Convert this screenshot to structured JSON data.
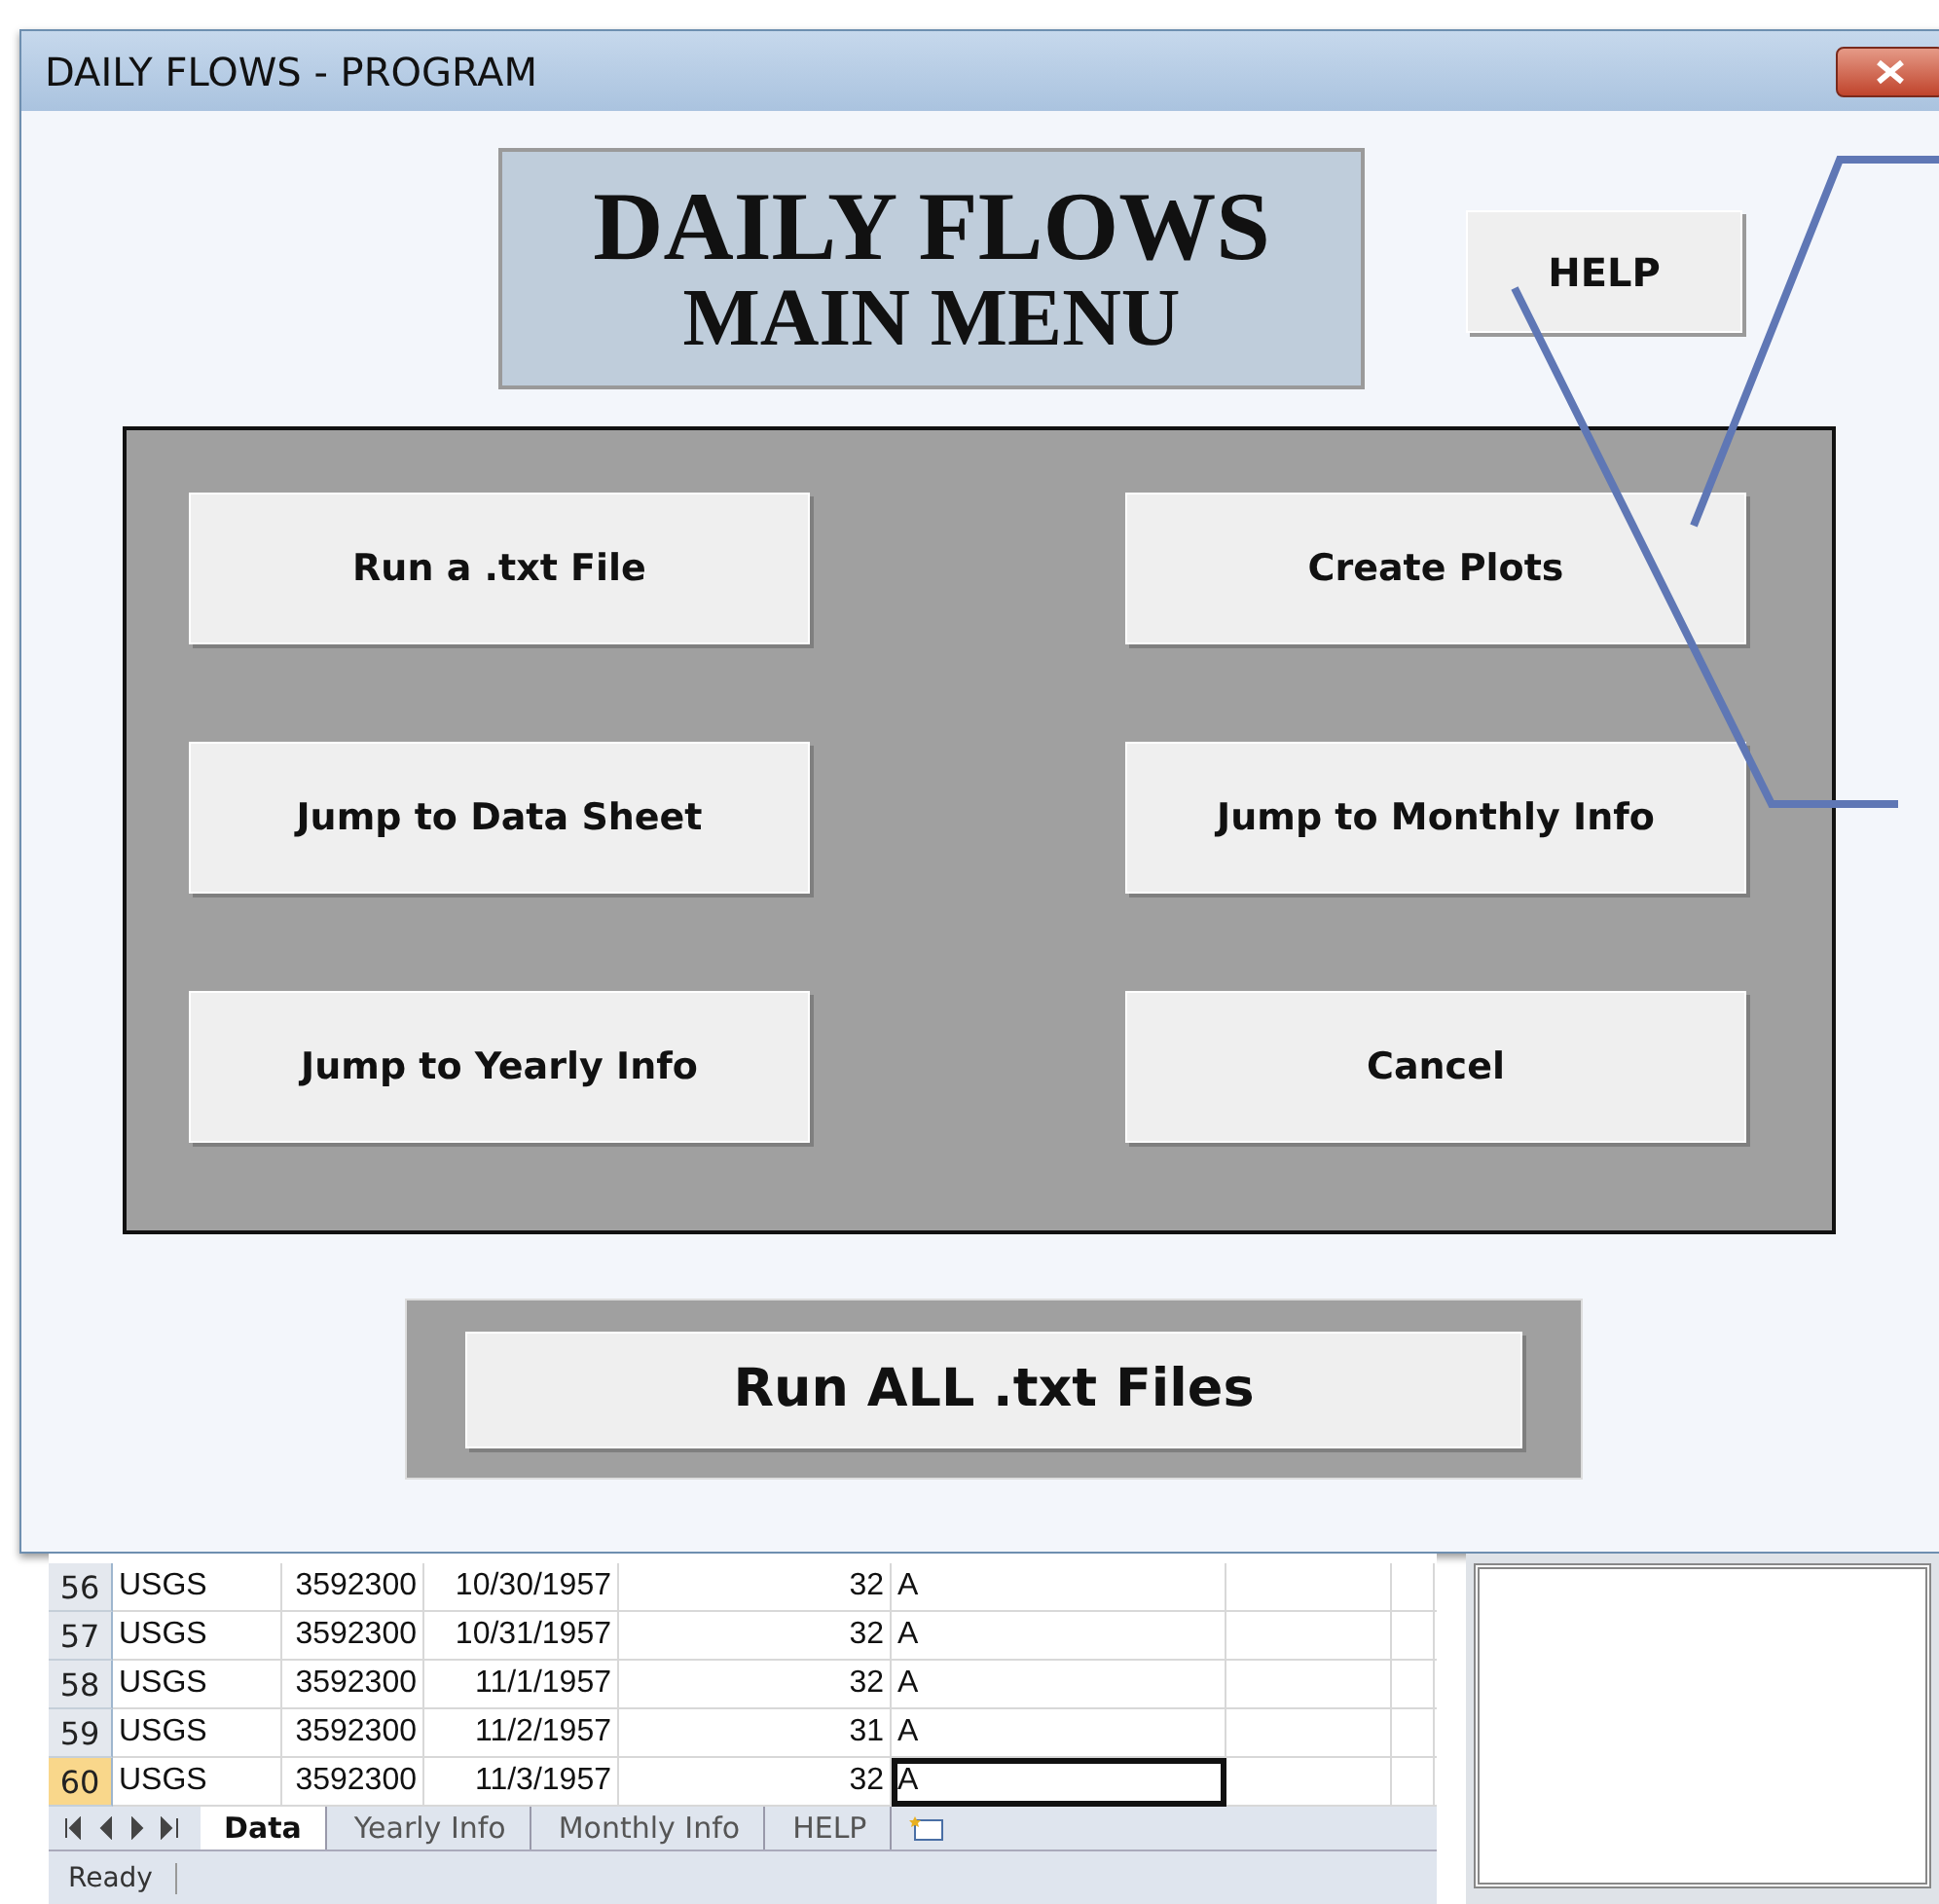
{
  "window": {
    "title": "DAILY FLOWS - PROGRAM"
  },
  "title_box": {
    "lines": [
      "DAILY FLOWS",
      "MAIN MENU"
    ]
  },
  "help_button": {
    "label": "HELP"
  },
  "menu_buttons": [
    {
      "label": "Run a .txt File"
    },
    {
      "label": "Create Plots"
    },
    {
      "label": "Jump to Data Sheet"
    },
    {
      "label": "Jump to Monthly Info"
    },
    {
      "label": "Jump to Yearly Info"
    },
    {
      "label": "Cancel"
    }
  ],
  "run_all_button": {
    "label": "Run ALL .txt Files"
  },
  "sheet": {
    "rows": [
      {
        "number": "56",
        "selected": false,
        "cells": [
          "USGS",
          "3592300",
          "10/30/1957",
          "32",
          "A"
        ],
        "active_cell": false
      },
      {
        "number": "57",
        "selected": false,
        "cells": [
          "USGS",
          "3592300",
          "10/31/1957",
          "32",
          "A"
        ],
        "active_cell": false
      },
      {
        "number": "58",
        "selected": false,
        "cells": [
          "USGS",
          "3592300",
          "11/1/1957",
          "32",
          "A"
        ],
        "active_cell": false
      },
      {
        "number": "59",
        "selected": false,
        "cells": [
          "USGS",
          "3592300",
          "11/2/1957",
          "31",
          "A"
        ],
        "active_cell": false
      },
      {
        "number": "60",
        "selected": true,
        "cells": [
          "USGS",
          "3592300",
          "11/3/1957",
          "32",
          "A"
        ],
        "active_cell": true
      }
    ],
    "tabs": [
      {
        "label": "Data",
        "selected": true
      },
      {
        "label": "Yearly Info",
        "selected": false
      },
      {
        "label": "Monthly Info",
        "selected": false
      },
      {
        "label": "HELP",
        "selected": false
      }
    ]
  },
  "status_bar": {
    "text": "Ready"
  }
}
